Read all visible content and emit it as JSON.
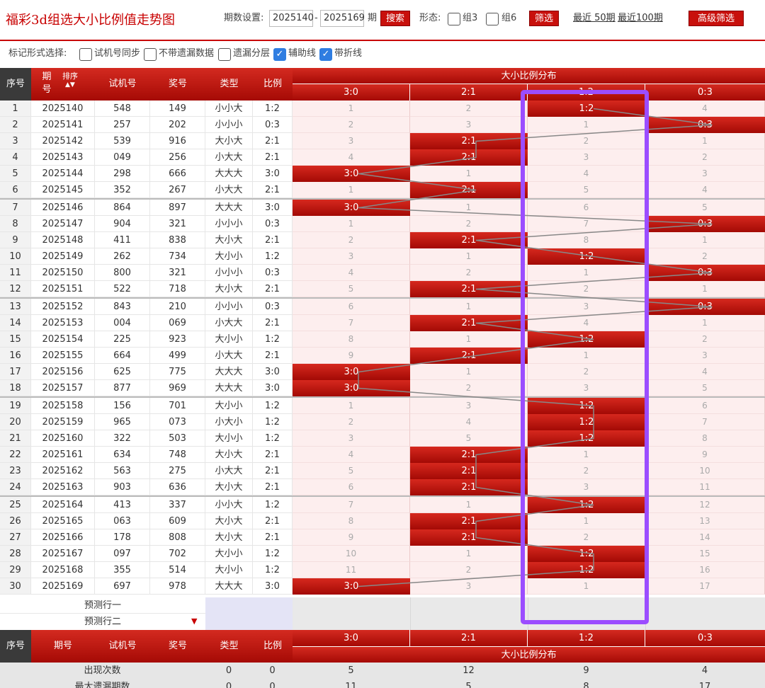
{
  "header": {
    "title": "福彩3d组选大小比例值走势图",
    "period_label": "期数设置:",
    "period_from": "2025140",
    "period_sep": "-",
    "period_to": "2025169",
    "period_unit": "期",
    "search_label": "搜索",
    "shape_label": "形态:",
    "group3": "组3",
    "group6": "组6",
    "filter_label": "筛选",
    "recent50": "最近 50期",
    "recent100": "最近100期",
    "advanced_label": "高级筛选"
  },
  "options": {
    "label": "标记形式选择:",
    "items": [
      {
        "label": "试机号同步",
        "checked": false
      },
      {
        "label": "不带遗漏数据",
        "checked": false
      },
      {
        "label": "遗漏分层",
        "checked": false
      },
      {
        "label": "辅助线",
        "checked": true
      },
      {
        "label": "带折线",
        "checked": true
      }
    ]
  },
  "columns": {
    "seq": "序号",
    "period": "期号",
    "sort": "排序",
    "trial": "试机号",
    "prize": "奖号",
    "type": "类型",
    "ratio": "比例",
    "distribution": "大小比例分布",
    "ratios": [
      "3:0",
      "2:1",
      "1:2",
      "0:3"
    ]
  },
  "rows": [
    {
      "seq": "1",
      "period": "2025140",
      "trial": "548",
      "prize": "149",
      "type": "小小大",
      "ratio": "1:2",
      "omit": [
        "1",
        "2",
        "1:2",
        "4"
      ]
    },
    {
      "seq": "2",
      "period": "2025141",
      "trial": "257",
      "prize": "202",
      "type": "小小小",
      "ratio": "0:3",
      "omit": [
        "2",
        "3",
        "1",
        "0:3"
      ]
    },
    {
      "seq": "3",
      "period": "2025142",
      "trial": "539",
      "prize": "916",
      "type": "大小大",
      "ratio": "2:1",
      "omit": [
        "3",
        "2:1",
        "2",
        "1"
      ]
    },
    {
      "seq": "4",
      "period": "2025143",
      "trial": "049",
      "prize": "256",
      "type": "小大大",
      "ratio": "2:1",
      "omit": [
        "4",
        "2:1",
        "3",
        "2"
      ]
    },
    {
      "seq": "5",
      "period": "2025144",
      "trial": "298",
      "prize": "666",
      "type": "大大大",
      "ratio": "3:0",
      "omit": [
        "3:0",
        "1",
        "4",
        "3"
      ]
    },
    {
      "seq": "6",
      "period": "2025145",
      "trial": "352",
      "prize": "267",
      "type": "小大大",
      "ratio": "2:1",
      "omit": [
        "1",
        "2:1",
        "5",
        "4"
      ]
    },
    {
      "seq": "7",
      "period": "2025146",
      "trial": "864",
      "prize": "897",
      "type": "大大大",
      "ratio": "3:0",
      "omit": [
        "3:0",
        "1",
        "6",
        "5"
      ]
    },
    {
      "seq": "8",
      "period": "2025147",
      "trial": "904",
      "prize": "321",
      "type": "小小小",
      "ratio": "0:3",
      "omit": [
        "1",
        "2",
        "7",
        "0:3"
      ]
    },
    {
      "seq": "9",
      "period": "2025148",
      "trial": "411",
      "prize": "838",
      "type": "大小大",
      "ratio": "2:1",
      "omit": [
        "2",
        "2:1",
        "8",
        "1"
      ]
    },
    {
      "seq": "10",
      "period": "2025149",
      "trial": "262",
      "prize": "734",
      "type": "大小小",
      "ratio": "1:2",
      "omit": [
        "3",
        "1",
        "1:2",
        "2"
      ]
    },
    {
      "seq": "11",
      "period": "2025150",
      "trial": "800",
      "prize": "321",
      "type": "小小小",
      "ratio": "0:3",
      "omit": [
        "4",
        "2",
        "1",
        "0:3"
      ]
    },
    {
      "seq": "12",
      "period": "2025151",
      "trial": "522",
      "prize": "718",
      "type": "大小大",
      "ratio": "2:1",
      "omit": [
        "5",
        "2:1",
        "2",
        "1"
      ]
    },
    {
      "seq": "13",
      "period": "2025152",
      "trial": "843",
      "prize": "210",
      "type": "小小小",
      "ratio": "0:3",
      "omit": [
        "6",
        "1",
        "3",
        "0:3"
      ]
    },
    {
      "seq": "14",
      "period": "2025153",
      "trial": "004",
      "prize": "069",
      "type": "小大大",
      "ratio": "2:1",
      "omit": [
        "7",
        "2:1",
        "4",
        "1"
      ]
    },
    {
      "seq": "15",
      "period": "2025154",
      "trial": "225",
      "prize": "923",
      "type": "大小小",
      "ratio": "1:2",
      "omit": [
        "8",
        "1",
        "1:2",
        "2"
      ]
    },
    {
      "seq": "16",
      "period": "2025155",
      "trial": "664",
      "prize": "499",
      "type": "小大大",
      "ratio": "2:1",
      "omit": [
        "9",
        "2:1",
        "1",
        "3"
      ]
    },
    {
      "seq": "17",
      "period": "2025156",
      "trial": "625",
      "prize": "775",
      "type": "大大大",
      "ratio": "3:0",
      "omit": [
        "3:0",
        "1",
        "2",
        "4"
      ]
    },
    {
      "seq": "18",
      "period": "2025157",
      "trial": "877",
      "prize": "969",
      "type": "大大大",
      "ratio": "3:0",
      "omit": [
        "3:0",
        "2",
        "3",
        "5"
      ]
    },
    {
      "seq": "19",
      "period": "2025158",
      "trial": "156",
      "prize": "701",
      "type": "大小小",
      "ratio": "1:2",
      "omit": [
        "1",
        "3",
        "1:2",
        "6"
      ]
    },
    {
      "seq": "20",
      "period": "2025159",
      "trial": "965",
      "prize": "073",
      "type": "小大小",
      "ratio": "1:2",
      "omit": [
        "2",
        "4",
        "1:2",
        "7"
      ]
    },
    {
      "seq": "21",
      "period": "2025160",
      "trial": "322",
      "prize": "503",
      "type": "大小小",
      "ratio": "1:2",
      "omit": [
        "3",
        "5",
        "1:2",
        "8"
      ]
    },
    {
      "seq": "22",
      "period": "2025161",
      "trial": "634",
      "prize": "748",
      "type": "大小大",
      "ratio": "2:1",
      "omit": [
        "4",
        "2:1",
        "1",
        "9"
      ]
    },
    {
      "seq": "23",
      "period": "2025162",
      "trial": "563",
      "prize": "275",
      "type": "小大大",
      "ratio": "2:1",
      "omit": [
        "5",
        "2:1",
        "2",
        "10"
      ]
    },
    {
      "seq": "24",
      "period": "2025163",
      "trial": "903",
      "prize": "636",
      "type": "大小大",
      "ratio": "2:1",
      "omit": [
        "6",
        "2:1",
        "3",
        "11"
      ]
    },
    {
      "seq": "25",
      "period": "2025164",
      "trial": "413",
      "prize": "337",
      "type": "小小大",
      "ratio": "1:2",
      "omit": [
        "7",
        "1",
        "1:2",
        "12"
      ]
    },
    {
      "seq": "26",
      "period": "2025165",
      "trial": "063",
      "prize": "609",
      "type": "大小大",
      "ratio": "2:1",
      "omit": [
        "8",
        "2:1",
        "1",
        "13"
      ]
    },
    {
      "seq": "27",
      "period": "2025166",
      "trial": "178",
      "prize": "808",
      "type": "大小大",
      "ratio": "2:1",
      "omit": [
        "9",
        "2:1",
        "2",
        "14"
      ]
    },
    {
      "seq": "28",
      "period": "2025167",
      "trial": "097",
      "prize": "702",
      "type": "大小小",
      "ratio": "1:2",
      "omit": [
        "10",
        "1",
        "1:2",
        "15"
      ]
    },
    {
      "seq": "29",
      "period": "2025168",
      "trial": "355",
      "prize": "514",
      "type": "大小小",
      "ratio": "1:2",
      "omit": [
        "11",
        "2",
        "1:2",
        "16"
      ]
    },
    {
      "seq": "30",
      "period": "2025169",
      "trial": "697",
      "prize": "978",
      "type": "大大大",
      "ratio": "3:0",
      "omit": [
        "3:0",
        "3",
        "1",
        "17"
      ]
    }
  ],
  "hit_index": [
    2,
    3,
    1,
    1,
    0,
    1,
    0,
    3,
    1,
    2,
    3,
    1,
    3,
    1,
    2,
    1,
    0,
    0,
    2,
    2,
    2,
    1,
    1,
    1,
    2,
    1,
    1,
    2,
    2,
    0
  ],
  "predict": {
    "row1": "预测行一",
    "row2": "预测行二"
  },
  "stats": {
    "appear_label": "出现次数",
    "appear": [
      "0",
      "0",
      "5",
      "12",
      "9",
      "4"
    ],
    "max_omit_label": "最大遗漏期数",
    "max_omit": [
      "0",
      "0",
      "11",
      "5",
      "8",
      "17"
    ]
  },
  "colors": {
    "accent": "#c8100c",
    "highlight_box": "#9b4dff",
    "cell_bg": "#fdeeee",
    "line": "#888888"
  }
}
